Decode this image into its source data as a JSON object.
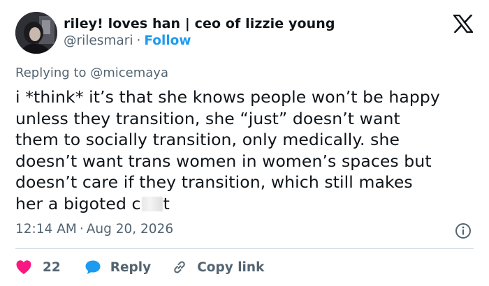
{
  "author": {
    "display_name": "riley! loves han | ceo of lizzie young",
    "handle": "@rilesmari",
    "separator": "·",
    "follow_label": "Follow"
  },
  "brand": {
    "logo_icon": "x-logo-icon",
    "follow_color": "#1d9bf0",
    "like_color": "#f91880",
    "reply_color": "#1d9bf0",
    "copy_color": "#1d9bf0"
  },
  "reply_context": {
    "prefix": "Replying to",
    "mention": "@micemaya"
  },
  "tweet": {
    "lines": [
      "i *think* it’s that she knows people won’t be happy",
      "unless they transition, she “just” doesn’t want",
      "them to socially transition, only medically. she",
      "doesn’t want trans women in women’s spaces but",
      "doesn’t care if they transition, which still makes"
    ],
    "last_line_before": "her a bigoted c",
    "last_line_after": "t"
  },
  "meta": {
    "time": "12:14 AM",
    "separator": "·",
    "date": "Aug 20, 2026",
    "info_icon": "info-icon"
  },
  "actions": {
    "like_count": "22",
    "like_icon": "heart-icon",
    "reply_label": "Reply",
    "reply_icon": "speech-bubble-icon",
    "copy_label": "Copy link",
    "copy_icon": "link-icon"
  }
}
